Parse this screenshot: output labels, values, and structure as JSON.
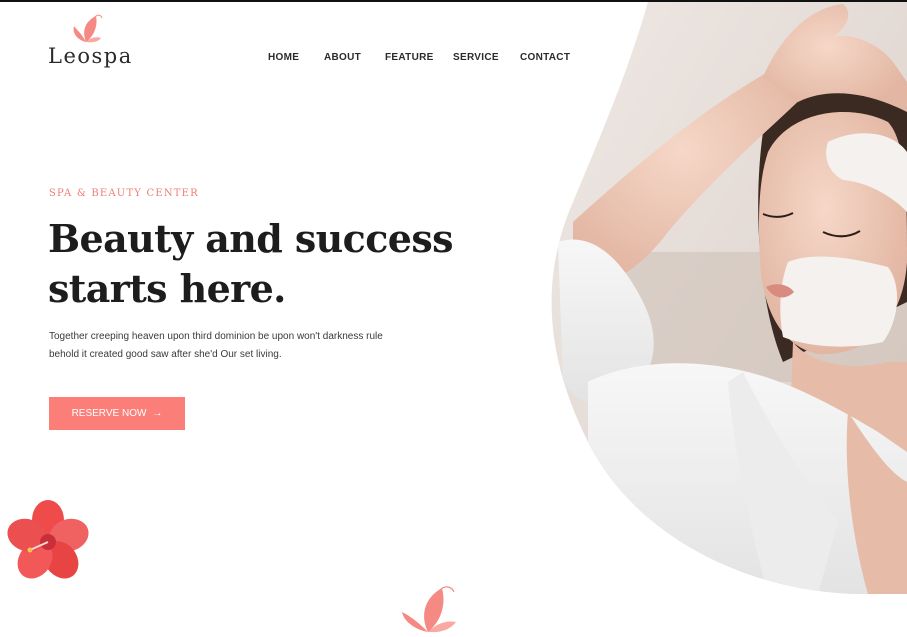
{
  "brand": {
    "name": "Leospa",
    "logo_icon": "butterfly-icon"
  },
  "nav": {
    "items": [
      "HOME",
      "ABOUT",
      "FEATURE",
      "SERVICE",
      "CONTACT"
    ]
  },
  "hero": {
    "eyebrow": "SPA & BEAUTY CENTER",
    "headline_line1": "Beauty and success",
    "headline_line2": "starts here.",
    "description_line1": "Together creeping heaven upon third dominion be upon won't darkness rule",
    "description_line2": "behold it created good saw after she'd Our set living.",
    "cta_label": "RESERVE NOW",
    "cta_icon": "arrow-right-icon"
  },
  "decor": {
    "flower_icon": "hibiscus-flower-icon",
    "bottom_icon": "butterfly-icon"
  },
  "colors": {
    "accent": "#fb7f78",
    "eyebrow": "#f07c73",
    "heading": "#1d1d1d",
    "text": "#3a3a3a"
  }
}
